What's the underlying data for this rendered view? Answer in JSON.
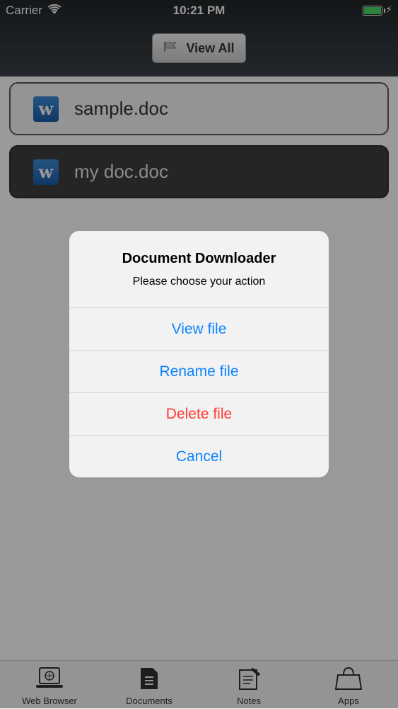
{
  "status_bar": {
    "carrier": "Carrier",
    "time": "10:21 PM"
  },
  "nav": {
    "view_all_label": "View All"
  },
  "documents": [
    {
      "name": "sample.doc",
      "icon": "word-doc-icon",
      "selected": false
    },
    {
      "name": "my doc.doc",
      "icon": "word-doc-icon",
      "selected": true
    }
  ],
  "alert": {
    "title": "Document Downloader",
    "message": "Please choose your action",
    "actions": [
      {
        "label": "View file",
        "style": "default"
      },
      {
        "label": "Rename file",
        "style": "default"
      },
      {
        "label": "Delete file",
        "style": "destructive"
      },
      {
        "label": "Cancel",
        "style": "cancel"
      }
    ]
  },
  "tab_bar": {
    "items": [
      {
        "label": "Web Browser",
        "icon": "laptop-globe-icon"
      },
      {
        "label": "Documents",
        "icon": "document-icon"
      },
      {
        "label": "Notes",
        "icon": "notes-icon"
      },
      {
        "label": "Apps",
        "icon": "shopping-bag-icon"
      }
    ]
  },
  "colors": {
    "accent": "#0a84ff",
    "destructive": "#ff3b30",
    "battery": "#4cd964"
  }
}
